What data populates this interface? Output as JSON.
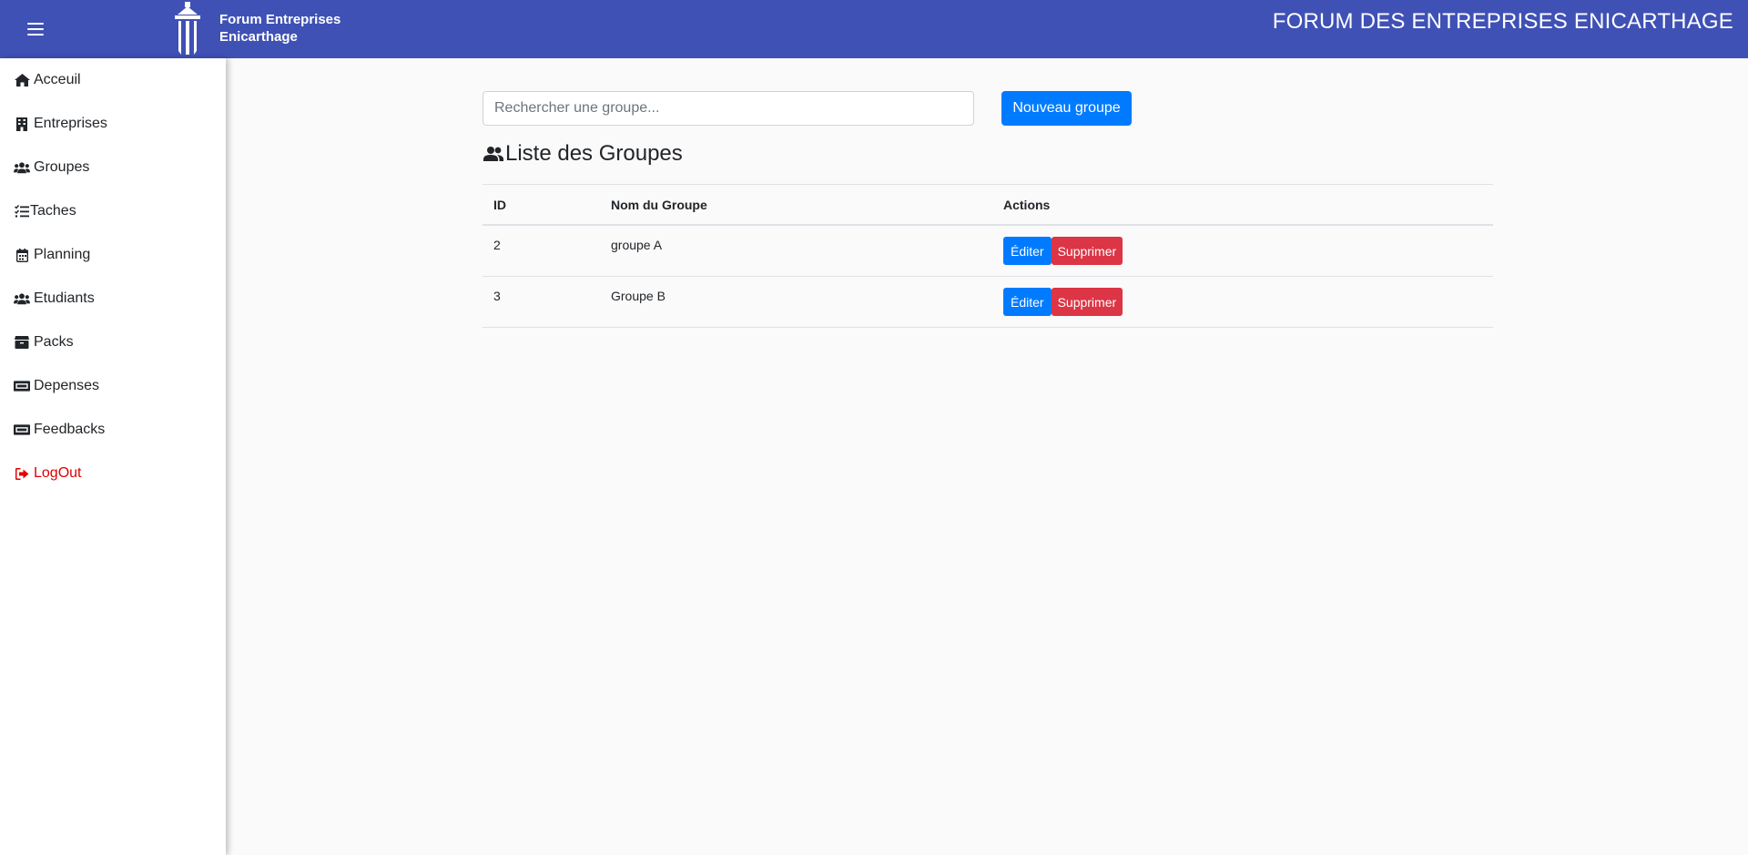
{
  "header": {
    "logo_line1": "Forum Entreprises",
    "logo_line2": "Enicarthage",
    "title": "FORUM DES ENTREPRISES ENICARTHAGE",
    "bg_color": "#3f51b5"
  },
  "sidebar": {
    "items": [
      {
        "label": "Acceuil",
        "icon": "home-icon"
      },
      {
        "label": "Entreprises",
        "icon": "building-icon"
      },
      {
        "label": "Groupes",
        "icon": "users-icon"
      },
      {
        "label": "Taches",
        "icon": "tasks-icon"
      },
      {
        "label": "Planning",
        "icon": "calendar-icon"
      },
      {
        "label": "Etudiants",
        "icon": "users-icon"
      },
      {
        "label": "Packs",
        "icon": "box-icon"
      },
      {
        "label": "Depenses",
        "icon": "money-bill-icon"
      },
      {
        "label": "Feedbacks",
        "icon": "money-bill-icon"
      },
      {
        "label": "LogOut",
        "icon": "sign-out-icon"
      }
    ]
  },
  "search": {
    "placeholder": "Rechercher une groupe..."
  },
  "new_group_label": "Nouveau groupe",
  "section_title": "Liste des Groupes",
  "table": {
    "headers": {
      "id": "ID",
      "name": "Nom du Groupe",
      "actions": "Actions"
    },
    "rows": [
      {
        "id": "2",
        "name": "groupe A"
      },
      {
        "id": "3",
        "name": "Groupe B"
      }
    ],
    "edit_label": "Éditer",
    "delete_label": "Supprimer"
  },
  "colors": {
    "primary": "#007bff",
    "danger": "#dc3545",
    "logout": "#e00000"
  }
}
